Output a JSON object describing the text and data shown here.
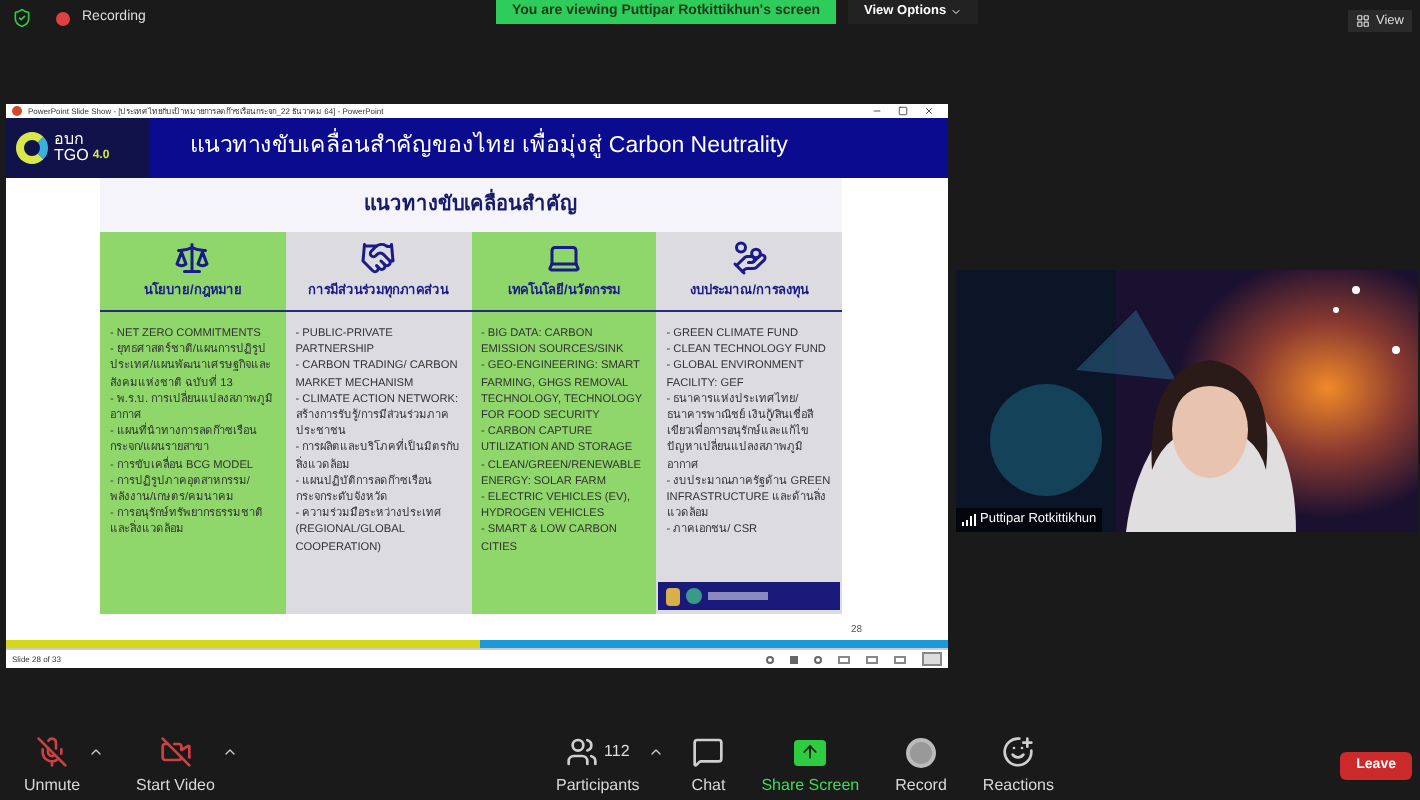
{
  "top_bar": {
    "recording": "Recording",
    "banner": "You are viewing Puttipar Rotkittikhun's screen",
    "view_options": "View Options",
    "view": "View"
  },
  "ppt_window": {
    "title": "PowerPoint Slide Show - [ประเทศไทยกับเป้าหมายการลดก๊าซเรือนกระจก_22 ธันวาคม 64] - PowerPoint",
    "slide": {
      "logo": {
        "top": "อบก",
        "bottom": "TGO",
        "version": "4.0"
      },
      "title": "แนวทางขับเคลื่อนสำคัญของไทย เพื่อมุ่งสู่ Carbon Neutrality",
      "subtitle": "แนวทางขับเคลื่อนสำคัญ",
      "columns": [
        {
          "kind": "scales",
          "color": "#8fd66b",
          "heading": "นโยบาย/กฎหมาย",
          "items": [
            "- NET ZERO COMMITMENTS",
            "- ยุทธศาสตร์ชาติ/แผนการปฏิรูปประเทศ/แผนพัฒนาเศรษฐกิจและสังคมแห่งชาติ ฉบับที่ 13",
            "- พ.ร.บ. การเปลี่ยนแปลงสภาพภูมิอากาศ",
            "- แผนที่นำทางการลดก๊าซเรือนกระจก/แผนรายสาขา",
            "- การขับเคลื่อน BCG MODEL",
            "- การปฏิรูปภาคอุตสาหกรรม/พลังงาน/เกษตร/คมนาคม",
            "- การอนุรักษ์ทรัพยากรธรรมชาติและสิ่งแวดล้อม"
          ],
          "footer": false
        },
        {
          "kind": "handshake",
          "color": "#dcdce0",
          "heading": "การมีส่วนร่วมทุกภาคส่วน",
          "items": [
            "- PUBLIC-PRIVATE PARTNERSHIP",
            "- CARBON TRADING/ CARBON MARKET MECHANISM",
            "- CLIMATE ACTION NETWORK: สร้างการรับรู้/การมีส่วนร่วมภาคประชาชน",
            "- การผลิตและบริโภคที่เป็นมิตรกับสิ่งแวดล้อม",
            "- แผนปฏิบัติการลดก๊าซเรือนกระจกระดับจังหวัด",
            "- ความร่วมมือระหว่างประเทศ (REGIONAL/GLOBAL COOPERATION)"
          ],
          "footer": false
        },
        {
          "kind": "laptop",
          "color": "#8fd66b",
          "heading": "เทคโนโลยี/นวัตกรรม",
          "items": [
            "- BIG DATA:  CARBON EMISSION SOURCES/SINK",
            "- GEO-ENGINEERING: SMART FARMING, GHGS REMOVAL TECHNOLOGY, TECHNOLOGY FOR FOOD SECURITY",
            "- CARBON CAPTURE UTILIZATION AND STORAGE",
            "- CLEAN/GREEN/RENEWABLE ENERGY: SOLAR FARM",
            "- ELECTRIC VEHICLES (EV), HYDROGEN VEHICLES",
            "- SMART & LOW CARBON CITIES"
          ],
          "footer": false
        },
        {
          "kind": "moneybag",
          "color": "#dcdce0",
          "heading": "งบประมาณ/การลงทุน",
          "items": [
            "- GREEN CLIMATE FUND",
            "- CLEAN TECHNOLOGY FUND",
            "- GLOBAL ENVIRONMENT FACILITY: GEF",
            "- ธนาคารแห่งประเทศไทย/ธนาคารพาณิชย์ เงินกู้/สินเชื่อสีเขียวเพื่อการอนุรักษ์และแก้ไขปัญหาเปลี่ยนแปลงสภาพภูมิอากาศ",
            "- งบประมาณภาครัฐด้าน GREEN INFRASTRUCTURE และด้านสิ่งแวดล้อม",
            "- ภาคเอกชน/ CSR"
          ],
          "footer": true
        }
      ],
      "page_number": "28"
    },
    "status": "Slide 28 of 33"
  },
  "video_tile": {
    "kind": "picture",
    "name": "Puttipar Rotkittikhun"
  },
  "toolbar": {
    "left": [
      {
        "kind": "mic-off",
        "label": "Unmute",
        "caret": true
      },
      {
        "kind": "video-off",
        "label": "Start Video",
        "caret": true
      }
    ],
    "center": [
      {
        "kind": "participants",
        "label": "Participants",
        "count": "112",
        "caret": true
      },
      {
        "kind": "chat",
        "label": "Chat",
        "caret": false
      },
      {
        "kind": "share",
        "label": "Share Screen",
        "caret": false
      },
      {
        "kind": "record",
        "label": "Record",
        "caret": false
      },
      {
        "kind": "reactions",
        "label": "Reactions",
        "caret": false
      }
    ],
    "leave": "Leave"
  }
}
